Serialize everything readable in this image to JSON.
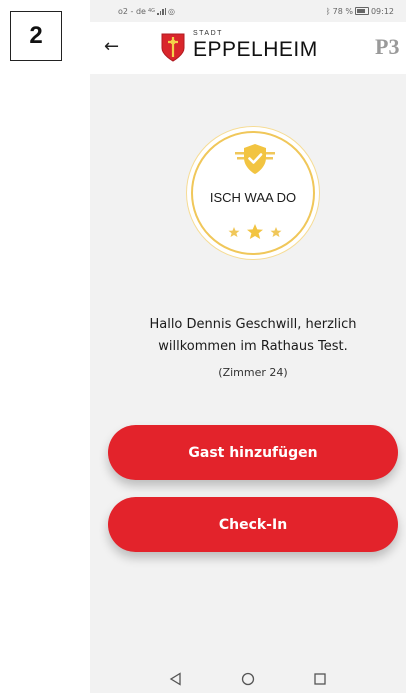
{
  "step_label": "2",
  "status_bar": {
    "carrier": "o2 - de",
    "network_tag": "4G",
    "battery_text": "78 %",
    "time": "09:12"
  },
  "header": {
    "back_icon": "back-arrow-icon",
    "logo_small": "STADT",
    "logo_name": "EPPELHEIM",
    "partner_logo": "P3"
  },
  "badge": {
    "text": "ISCH WAA DO",
    "accent_color": "#f0c75a"
  },
  "greeting": {
    "line1": "Hallo Dennis Geschwill, herzlich",
    "line2": "willkommen im Rathaus Test.",
    "room": "(Zimmer 24)"
  },
  "buttons": {
    "add_guest": "Gast hinzufügen",
    "check_in": "Check-In",
    "color": "#e3232b"
  },
  "nav": {
    "back": "triangle-back-icon",
    "home": "circle-home-icon",
    "recents": "square-recents-icon"
  }
}
